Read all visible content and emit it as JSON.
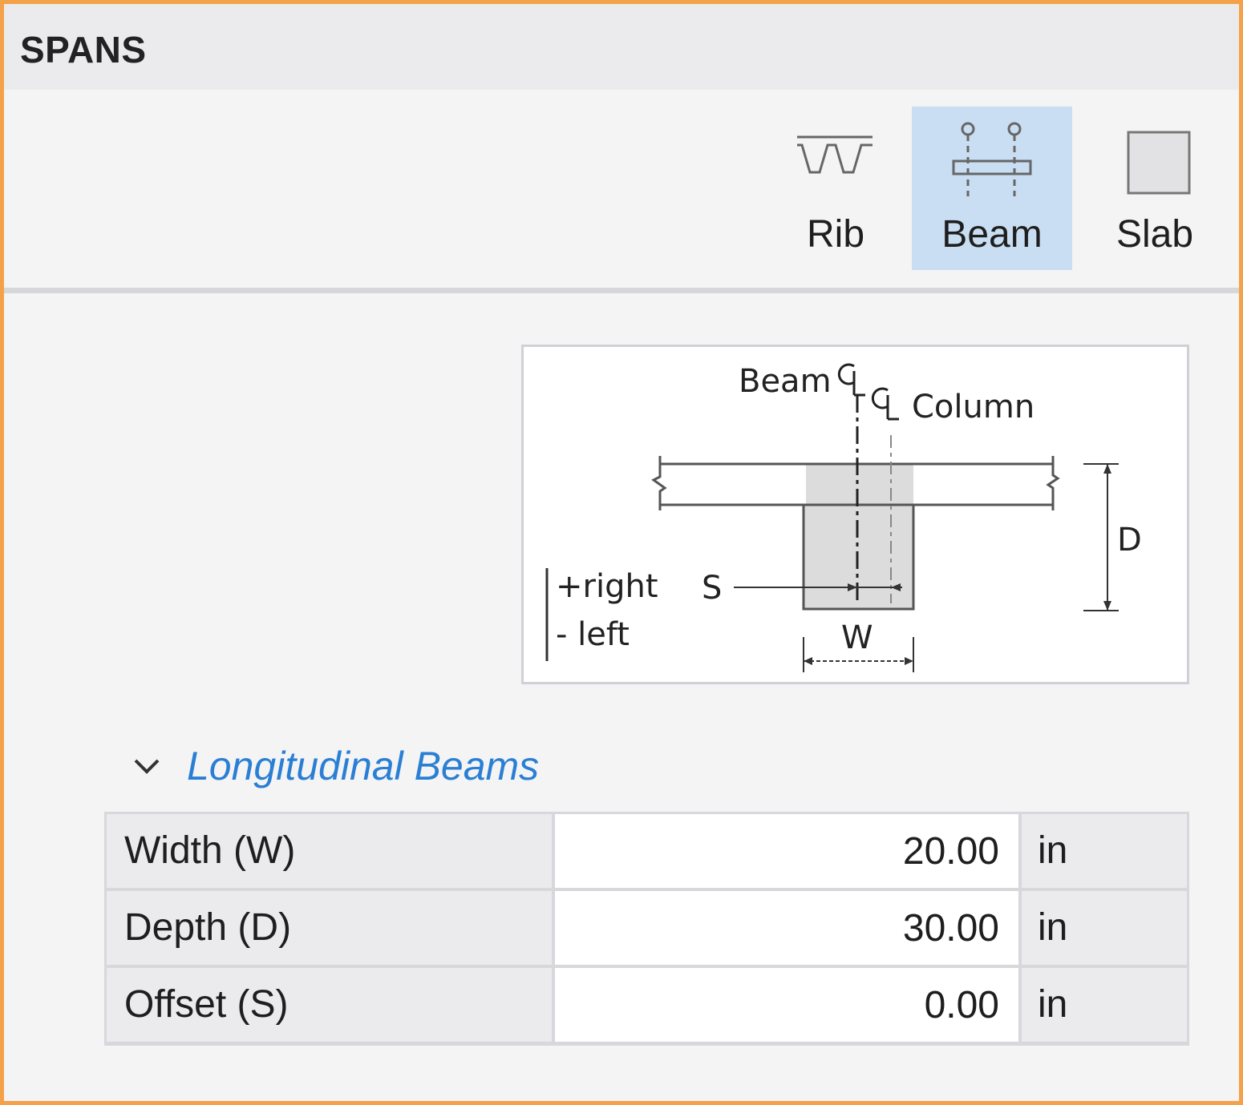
{
  "panel": {
    "title": "SPANS"
  },
  "span_types": [
    {
      "id": "rib",
      "label": "Rib",
      "icon": "rib-icon",
      "selected": false
    },
    {
      "id": "beam",
      "label": "Beam",
      "icon": "beam-icon",
      "selected": true
    },
    {
      "id": "slab",
      "label": "Slab",
      "icon": "slab-icon",
      "selected": false
    }
  ],
  "diagram": {
    "beam_cl_label": "Beam",
    "column_cl_label": "Column",
    "s_label": "S",
    "d_label": "D",
    "w_label": "W",
    "right_label": "+right",
    "left_label": "- left"
  },
  "section": {
    "title": "Longitudinal Beams",
    "expanded": true
  },
  "properties": [
    {
      "label": "Width (W)",
      "value": "20.00",
      "unit": "in"
    },
    {
      "label": "Depth (D)",
      "value": "30.00",
      "unit": "in"
    },
    {
      "label": "Offset (S)",
      "value": "0.00",
      "unit": "in"
    }
  ],
  "colors": {
    "accent": "#2a7fd4",
    "selected_bg": "#c9def2",
    "frame_border": "#f4a24a"
  }
}
